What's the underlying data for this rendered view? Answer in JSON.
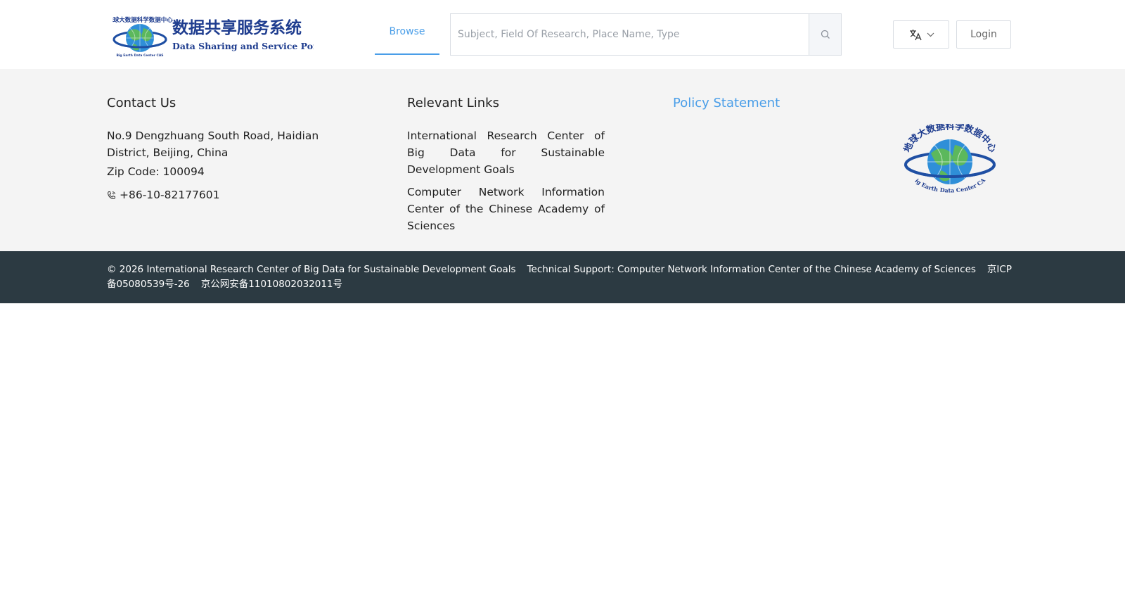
{
  "header": {
    "logo_title_cn": "数据共享服务系统",
    "logo_title_en": "Data Sharing and Service Portal",
    "logo_ring_text": "地球大数据科学数据中心",
    "logo_ring_text_en": "Big Earth Data Center CAS",
    "nav_browse": "Browse",
    "search_placeholder": "Subject, Field Of Research, Place Name, Type",
    "login_label": "Login",
    "accent_color": "#4a9ee8"
  },
  "footer": {
    "contact_title": "Contact Us",
    "address": "No.9 Dengzhuang South Road, Haidian District, Beijing, China",
    "zip": "Zip Code: 100094",
    "phone": "+86-10-82177601",
    "links_title": "Relevant Links",
    "links": [
      "International Research Center of Big Data for Sustainable Development Goals",
      "Computer Network Information Center of the Chinese Academy of Sciences"
    ],
    "policy_title": "Policy Statement"
  },
  "copyright": {
    "owner": "© 2026 International Research Center of Big Data for Sustainable Development Goals",
    "support": "Technical Support: Computer Network Information Center of the Chinese Academy of Sciences",
    "icp": "京ICP备05080539号-26",
    "police": "京公网安备11010802032011号",
    "bar_color": "#2c3a42"
  }
}
